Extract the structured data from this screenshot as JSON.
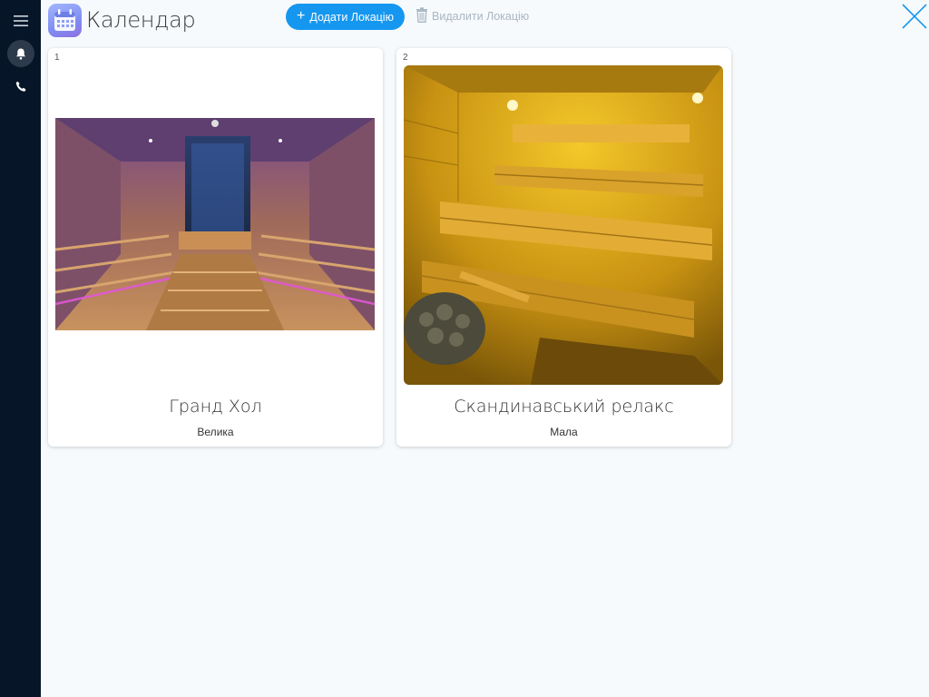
{
  "header": {
    "title": "Календар",
    "add_location_label": "Додати Локацію",
    "delete_location_label": "Видалити Локацію"
  },
  "locations": [
    {
      "number": "1",
      "name": "Гранд Хол",
      "size": "Велика"
    },
    {
      "number": "2",
      "name": "Скандинавський релакс",
      "size": "Мала"
    }
  ],
  "colors": {
    "sidebar": "#061528",
    "accent": "#1597f0",
    "disabled": "#a9b6c4",
    "background": "#f7fafc"
  },
  "icons": {
    "sidebar": [
      "menu-icon",
      "bell-icon",
      "phone-icon"
    ],
    "app": "calendar-icon",
    "add": "plus-icon",
    "delete": "trash-icon",
    "close": "close-icon"
  }
}
